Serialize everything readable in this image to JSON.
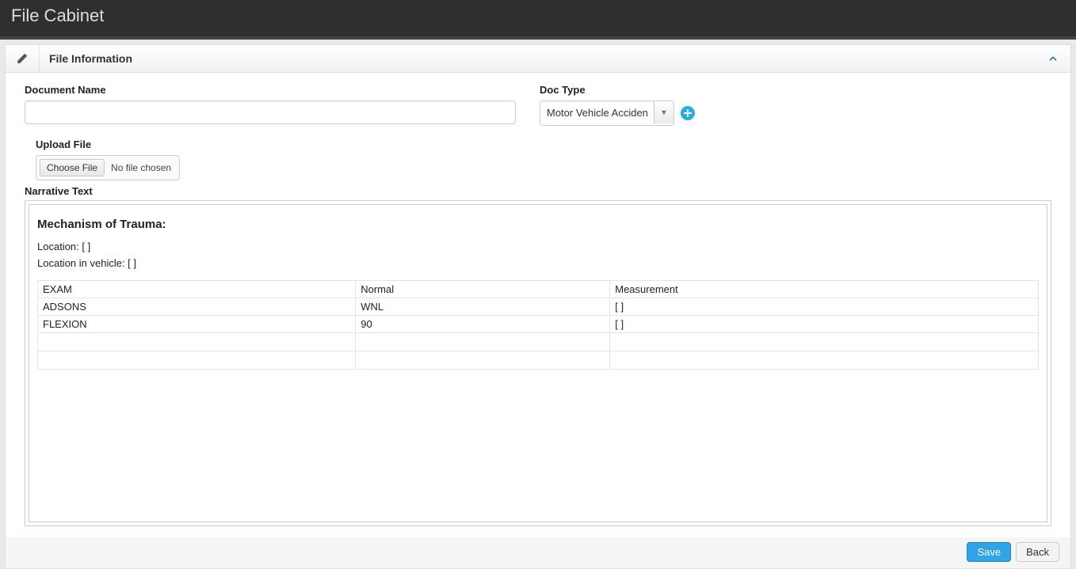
{
  "app": {
    "title": "File Cabinet"
  },
  "panel": {
    "title": "File Information"
  },
  "form": {
    "document_name": {
      "label": "Document Name",
      "value": ""
    },
    "doc_type": {
      "label": "Doc Type",
      "selected": "Motor Vehicle Acciden"
    },
    "upload": {
      "label": "Upload File",
      "button": "Choose File",
      "status": "No file chosen"
    },
    "narrative_label": "Narrative Text"
  },
  "narrative": {
    "heading": "Mechanism of Trauma:",
    "location_line": "Location: [ ]",
    "vehicle_line": "Location in vehicle: [ ]",
    "table": {
      "headers": [
        "EXAM",
        "Normal",
        "Measurement"
      ],
      "rows": [
        [
          "ADSONS",
          "WNL",
          "[ ]"
        ],
        [
          "FLEXION",
          "90",
          "[ ]"
        ]
      ]
    }
  },
  "footer": {
    "save": "Save",
    "back": "Back"
  }
}
